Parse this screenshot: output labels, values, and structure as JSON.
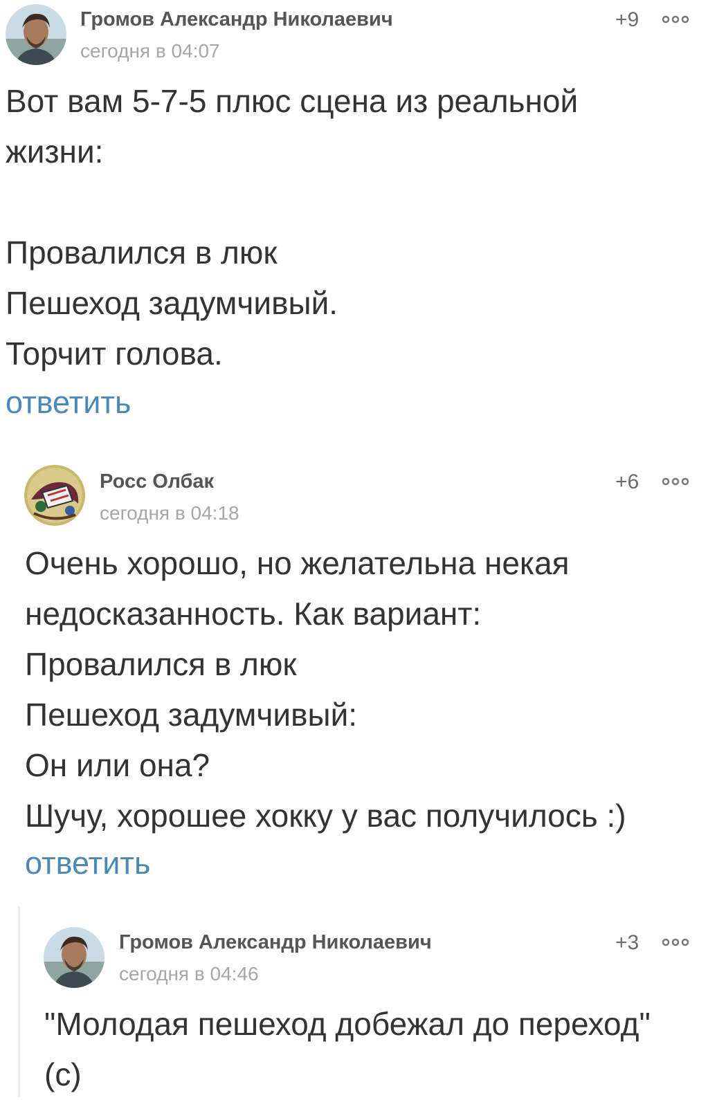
{
  "comments": [
    {
      "author": "Громов Александр Николаевич",
      "time": "сегодня в 04:07",
      "rating": "+9",
      "more_icon": "more-dots-icon",
      "lines": [
        "Вот вам 5-7-5 плюс сцена из реальной",
        "жизни:",
        "",
        "Провалился в люк",
        "Пешеход задумчивый.",
        "Торчит голова."
      ],
      "reply_label": "ответить"
    },
    {
      "author": "Росс Олбак",
      "time": "сегодня в 04:18",
      "rating": "+6",
      "more_icon": "more-dots-icon",
      "lines": [
        "Очень хорошо, но желательна некая",
        "недосказанность. Как вариант:",
        "Провалился в люк",
        "Пешеход задумчивый:",
        "Он или она?",
        "Шучу, хорошее хокку у вас получилось :)"
      ],
      "reply_label": "ответить"
    },
    {
      "author": "Громов Александр Николаевич",
      "time": "сегодня в 04:46",
      "rating": "+3",
      "more_icon": "more-dots-icon",
      "lines": [
        "\"Молодая пешеход добежал до переход\"",
        "(с)"
      ]
    }
  ],
  "colors": {
    "link": "#4a89b6",
    "text": "#333333",
    "meta": "#a6a6a6",
    "author": "#555555"
  }
}
